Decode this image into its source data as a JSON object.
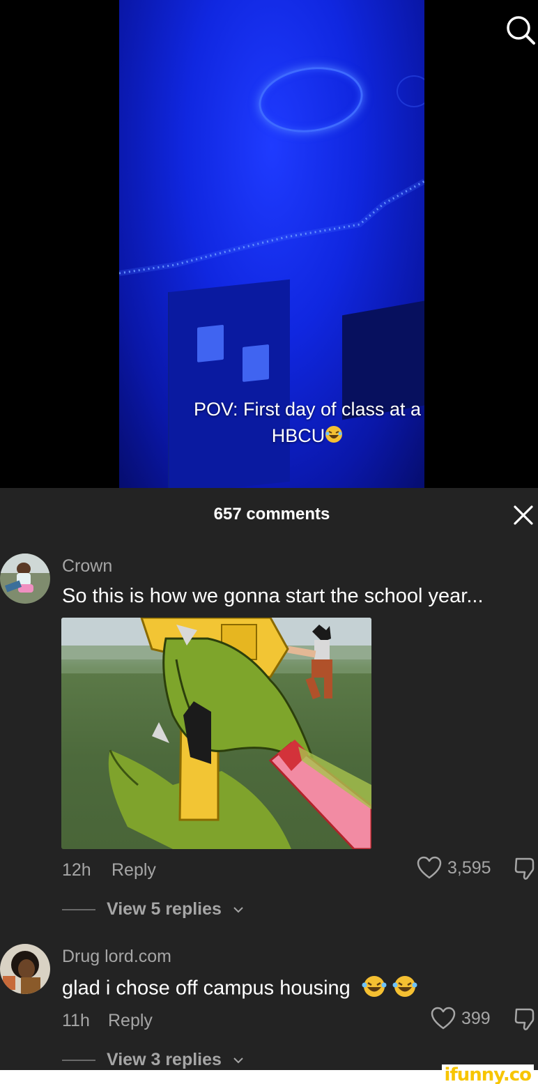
{
  "video": {
    "caption_line1": "POV: First day of class at a",
    "caption_line2": "HBCU"
  },
  "header": {
    "search_icon": "search-icon"
  },
  "comments_panel": {
    "title": "657 comments",
    "close_icon": "close-icon",
    "comments": [
      {
        "user": "Crown",
        "text": "So this is how we gonna start the school year...",
        "time": "12h",
        "reply_label": "Reply",
        "likes": "3,595",
        "view_replies": "View 5 replies"
      },
      {
        "user": "Drug lord.com",
        "text": "glad i chose off campus housing",
        "time": "11h",
        "reply_label": "Reply",
        "likes": "399",
        "view_replies": "View 3 replies"
      }
    ]
  },
  "footer": {
    "watermark": "ifunny.co"
  },
  "colors": {
    "panel_bg": "#232323",
    "muted_text": "#a6a6a6",
    "watermark": "#f7c500"
  }
}
